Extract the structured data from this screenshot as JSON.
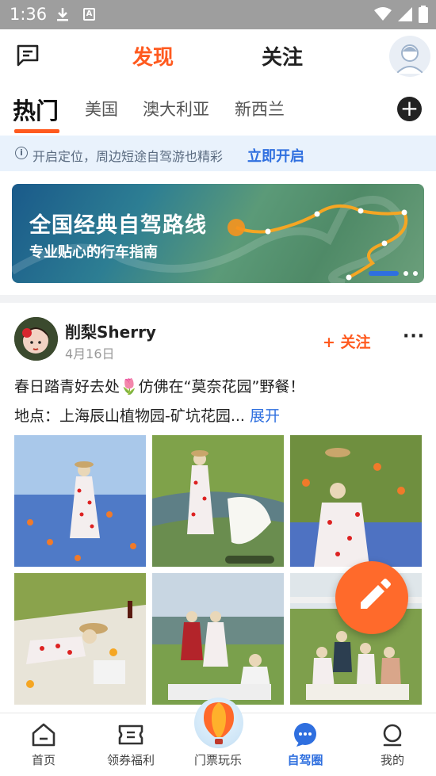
{
  "status_bar": {
    "time": "1:36"
  },
  "header": {
    "tab_discover": "发现",
    "tab_follow": "关注"
  },
  "categories": [
    {
      "label": "热门",
      "active": true
    },
    {
      "label": "美国",
      "active": false
    },
    {
      "label": "澳大利亚",
      "active": false
    },
    {
      "label": "新西兰",
      "active": false
    }
  ],
  "location_tip": {
    "text": "开启定位，周边短途自驾游也精彩",
    "action": "立即开启"
  },
  "banner": {
    "title": "全国经典自驾路线",
    "subtitle": "专业贴心的行车指南"
  },
  "post": {
    "username": "削梨Sherry",
    "date": "4月16日",
    "follow_label": "+ 关注",
    "more_label": "···",
    "text": "春日踏青好去处🌷仿佛在“莫奈花园”野餐！",
    "location_prefix": "地点：上海辰山植物园-矿坑花园...",
    "expand_label": "展开"
  },
  "bottom_nav": [
    {
      "label": "首页",
      "icon": "home-icon",
      "active": false
    },
    {
      "label": "领券福利",
      "icon": "ticket-icon",
      "active": false
    },
    {
      "label": "门票玩乐",
      "icon": "balloon-icon",
      "active": false
    },
    {
      "label": "自驾圈",
      "icon": "chat-bubble-icon",
      "active": true
    },
    {
      "label": "我的",
      "icon": "profile-icon",
      "active": false
    }
  ],
  "colors": {
    "accent_orange": "#ff5a1f",
    "accent_blue": "#2f6fdf",
    "tip_bg": "#e9f2fc"
  }
}
